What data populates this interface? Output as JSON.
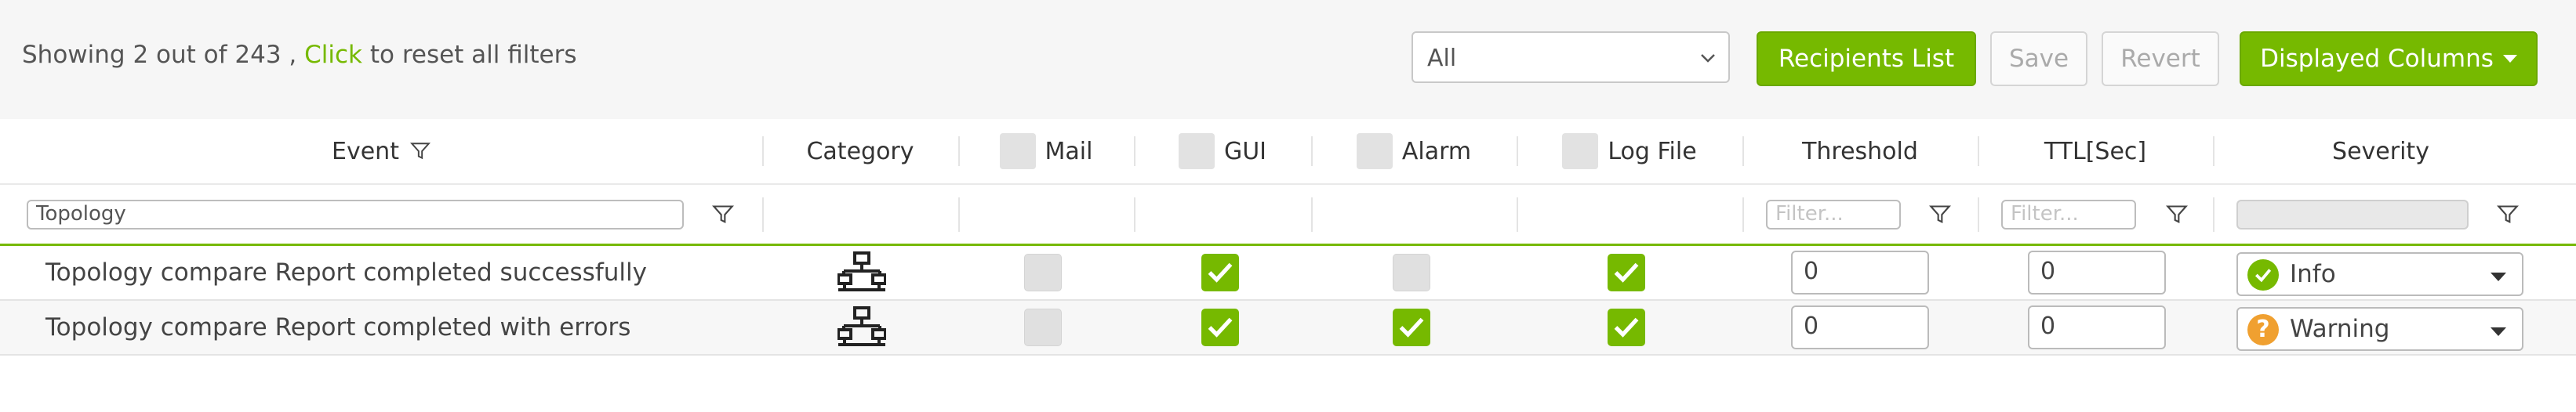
{
  "status": {
    "prefix": "Showing 2 out of 243 , ",
    "link": "Click",
    "suffix": " to reset all filters"
  },
  "toolbar": {
    "filter_select": "All",
    "recipients_label": "Recipients List",
    "save_label": "Save",
    "revert_label": "Revert",
    "columns_label": "Displayed Columns"
  },
  "columns": {
    "event": "Event",
    "category": "Category",
    "mail": "Mail",
    "gui": "GUI",
    "alarm": "Alarm",
    "logfile": "Log File",
    "threshold": "Threshold",
    "ttl": "TTL[Sec]",
    "severity": "Severity"
  },
  "filters": {
    "event_value": "Topology",
    "threshold_placeholder": "Filter...",
    "ttl_placeholder": "Filter..."
  },
  "rows": [
    {
      "event": "Topology compare Report completed successfully",
      "category_icon": "topology-icon",
      "mail": false,
      "gui": true,
      "alarm": false,
      "logfile": true,
      "threshold": "0",
      "ttl": "0",
      "severity": "Info",
      "severity_icon": "check-circle-icon",
      "severity_color": "#76b900"
    },
    {
      "event": "Topology compare Report completed with errors",
      "category_icon": "topology-icon",
      "mail": false,
      "gui": true,
      "alarm": true,
      "logfile": true,
      "threshold": "0",
      "ttl": "0",
      "severity": "Warning",
      "severity_icon": "question-circle-icon",
      "severity_color": "#f0a030"
    }
  ],
  "colors": {
    "accent": "#76b900",
    "warning": "#f0a030"
  }
}
